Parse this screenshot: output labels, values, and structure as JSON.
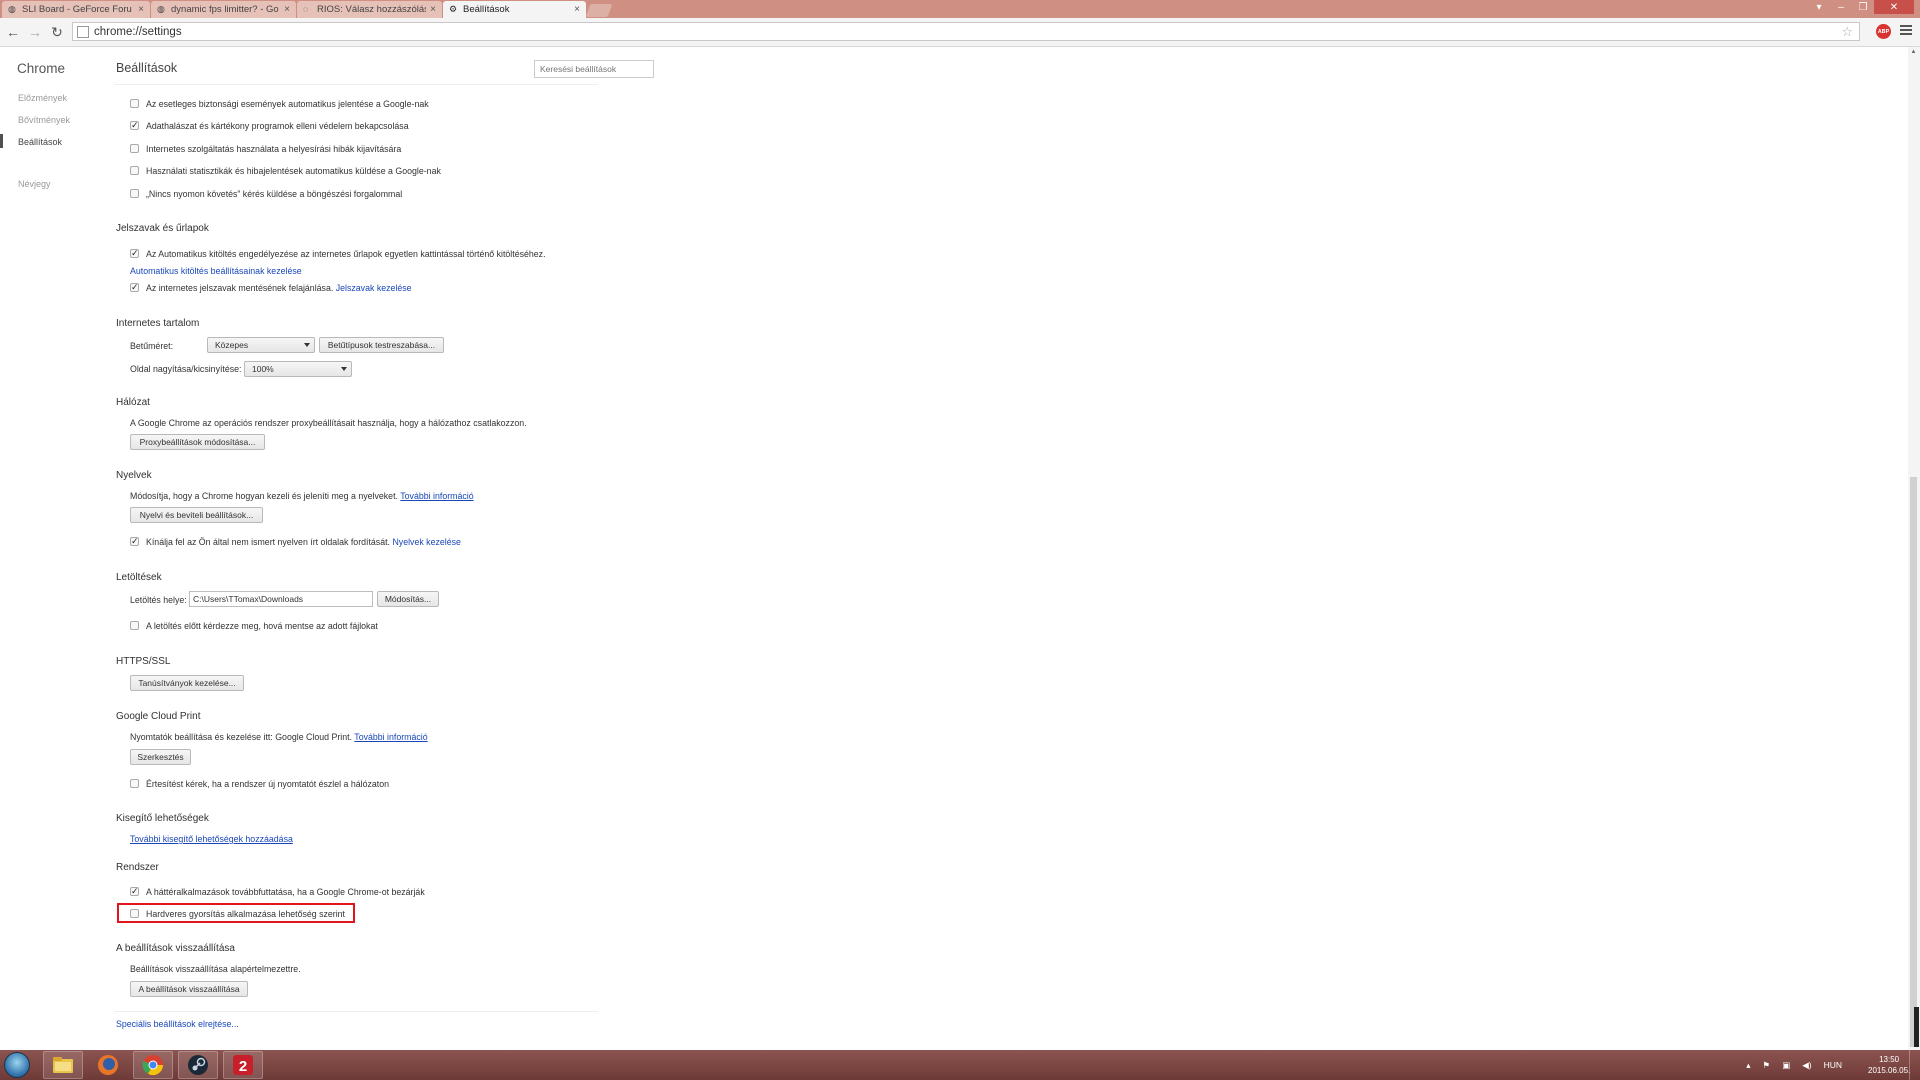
{
  "browser": {
    "tabs": [
      {
        "label": "SLI Board - GeForce Foru",
        "active": false
      },
      {
        "label": "dynamic fps limitter? - Go",
        "active": false
      },
      {
        "label": "RIOS: Válasz hozzászólás",
        "active": false
      },
      {
        "label": "Beállítások",
        "active": true
      }
    ],
    "url": "chrome://settings",
    "abp_label": "ABP"
  },
  "sidebar": {
    "title": "Chrome",
    "items": [
      {
        "label": "Előzmények"
      },
      {
        "label": "Bővítmények"
      },
      {
        "label": "Beállítások"
      },
      {
        "label": "Névjegy"
      }
    ]
  },
  "header": {
    "title": "Beállítások",
    "search_placeholder": "Keresési beállítások"
  },
  "privacy": {
    "items": [
      {
        "label": "Az esetleges biztonsági események automatikus jelentése a Google-nak",
        "checked": false
      },
      {
        "label": "Adathalászat és kártékony programok elleni védelem bekapcsolása",
        "checked": true
      },
      {
        "label": "Internetes szolgáltatás használata a helyesírási hibák kijavítására",
        "checked": false
      },
      {
        "label": "Használati statisztikák és hibajelentések automatikus küldése a Google-nak",
        "checked": false
      },
      {
        "label": "„Nincs nyomon követés” kérés küldése a böngészési forgalommal",
        "checked": false
      }
    ]
  },
  "passwords": {
    "title": "Jelszavak és űrlapok",
    "autofill_label": "Az Automatikus kitöltés engedélyezése az internetes űrlapok egyetlen kattintással történő kitöltéséhez.",
    "autofill_link": "Automatikus kitöltés beállításainak kezelése",
    "save_label": "Az internetes jelszavak mentésének felajánlása.",
    "save_link": "Jelszavak kezelése"
  },
  "web_content": {
    "title": "Internetes tartalom",
    "font_size_label": "Betűméret:",
    "font_size_value": "Közepes",
    "customize_fonts_button": "Betűtípusok testreszabása...",
    "zoom_label": "Oldal nagyítása/kicsinyítése:",
    "zoom_value": "100%"
  },
  "network": {
    "title": "Hálózat",
    "description": "A Google Chrome az operációs rendszer proxybeállításait használja, hogy a hálózathoz csatlakozzon.",
    "proxy_button": "Proxybeállítások módosítása..."
  },
  "languages": {
    "title": "Nyelvek",
    "description": "Módosítja, hogy a Chrome hogyan kezeli és jeleníti meg a nyelveket.",
    "more_info_link": "További információ",
    "settings_button": "Nyelvi és beviteli beállítások...",
    "translate_label": "Kínálja fel az Ön által nem ismert nyelven írt oldalak fordítását.",
    "translate_link": "Nyelvek kezelése"
  },
  "downloads": {
    "title": "Letöltések",
    "location_label": "Letöltés helye:",
    "location_value": "C:\\Users\\TTomax\\Downloads",
    "change_button": "Módosítás...",
    "ask_label": "A letöltés előtt kérdezze meg, hová mentse az adott fájlokat"
  },
  "https": {
    "title": "HTTPS/SSL",
    "certs_button": "Tanúsítványok kezelése..."
  },
  "cloud_print": {
    "title": "Google Cloud Print",
    "description": "Nyomtatók beállítása és kezelése itt: Google Cloud Print.",
    "more_info_link": "További információ",
    "manage_button": "Szerkesztés",
    "notify_label": "Értesítést kérek, ha a rendszer új nyomtatót észlel a hálózaton"
  },
  "accessibility": {
    "title": "Kisegítő lehetőségek",
    "add_link": "További kisegítő lehetőségek hozzáadása"
  },
  "system": {
    "title": "Rendszer",
    "background_label": "A háttéralkalmazások továbbfuttatása, ha a Google Chrome-ot bezárják",
    "hw_accel_label": "Hardveres gyorsítás alkalmazása lehetőség szerint"
  },
  "reset": {
    "title": "A beállítások visszaállítása",
    "description": "Beállítások visszaállítása alapértelmezettre.",
    "reset_button": "A beállítások visszaállítása"
  },
  "advanced_link": "Speciális beállítások elrejtése...",
  "taskbar": {
    "language": "HUN",
    "time": "13:50",
    "date": "2015.06.05."
  }
}
